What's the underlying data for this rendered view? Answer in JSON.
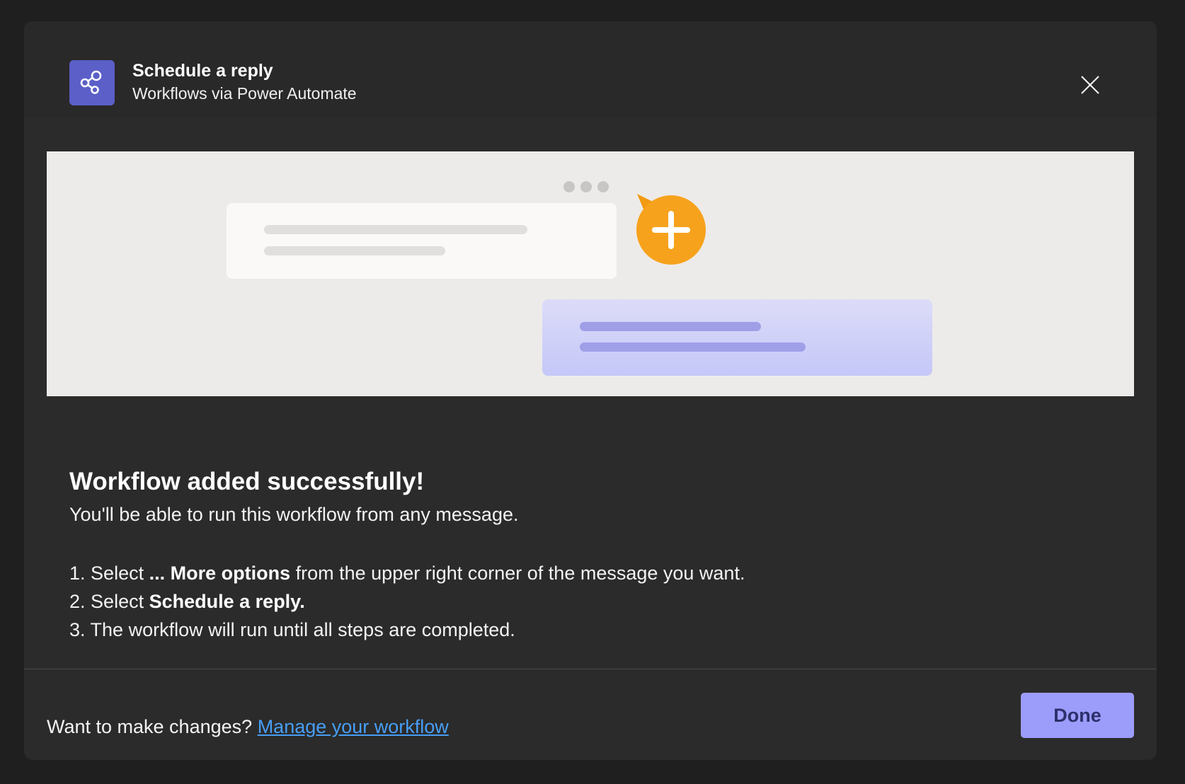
{
  "header": {
    "title": "Schedule a reply",
    "subtitle": "Workflows via Power Automate",
    "app_icon": "workflow-share-icon",
    "close_icon": "close-icon"
  },
  "illustration": {
    "badge_icon": "plus-icon",
    "more_icon": "ellipsis-icon"
  },
  "content": {
    "heading": "Workflow added successfully!",
    "description": "You'll be able to run this workflow from any message.",
    "steps": [
      {
        "number": "1.",
        "prefix": "Select",
        "bold": "... More options",
        "suffix": "from the upper right corner of the message you want."
      },
      {
        "number": "2.",
        "prefix": "Select",
        "bold": "Schedule a reply.",
        "suffix": ""
      },
      {
        "number": "3.",
        "prefix": "The workflow will run until all steps are completed.",
        "bold": "",
        "suffix": ""
      }
    ]
  },
  "footer": {
    "prompt": "Want to make changes?",
    "link_label": "Manage your workflow",
    "done_label": "Done"
  },
  "colors": {
    "page_bg": "#1f1f1f",
    "dialog_bg": "#2b2b2b",
    "app_icon_bg": "#5b5fc7",
    "link": "#479ef5",
    "done_button_bg": "#9c9cfb",
    "badge_orange": "#f7a21c"
  }
}
